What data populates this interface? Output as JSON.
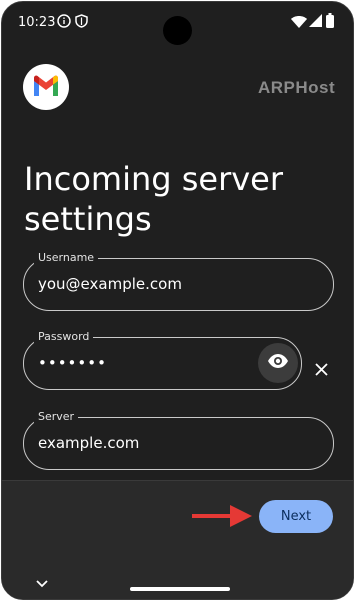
{
  "status_bar": {
    "time": "10:23",
    "left_icons": [
      "info-circle-icon",
      "shield-icon"
    ],
    "right_icons": [
      "wifi-icon",
      "cellular-signal-icon",
      "battery-icon"
    ]
  },
  "header": {
    "logo": "gmail-logo",
    "watermark": "ARPHost"
  },
  "page": {
    "title": "Incoming server settings"
  },
  "form": {
    "username": {
      "label": "Username",
      "value": "you@example.com"
    },
    "password": {
      "label": "Password",
      "value": "•••••••",
      "toggle_icon": "eye-icon"
    },
    "clear_icon": "close-icon",
    "server": {
      "label": "Server",
      "value": "example.com"
    }
  },
  "footer": {
    "next_label": "Next",
    "arrow_color": "#e53935",
    "accent": "#8ab4f8"
  },
  "nav": {
    "chevron_icon": "chevron-down-icon"
  }
}
